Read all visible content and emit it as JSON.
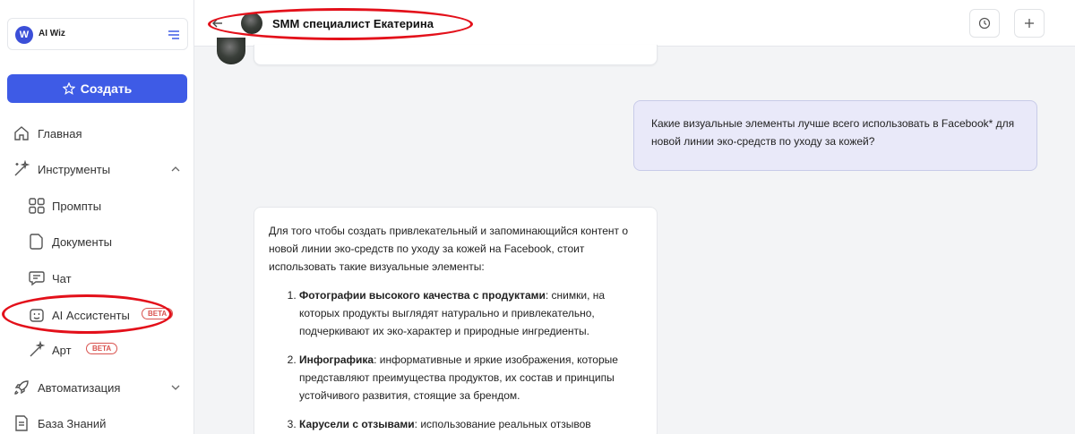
{
  "sidebar": {
    "brand_name": "AI Wiz",
    "create_label": "Создать",
    "items": {
      "home": "Главная",
      "tools": "Инструменты",
      "prompts": "Промпты",
      "documents": "Документы",
      "chat": "Чат",
      "assistants": "AI Ассистенты",
      "art": "Арт",
      "automation": "Автоматизация",
      "knowledge": "База Знаний"
    },
    "beta_label": "BETA"
  },
  "header": {
    "title": "SMM специалист Екатерина"
  },
  "chat": {
    "user_message": "Какие визуальные элементы лучше всего использовать в Facebook* для новой линии эко-средств по уходу за кожей?",
    "bot_intro": "Для того чтобы создать привлекательный и запоминающийся контент о новой линии эко-средств по уходу за кожей на Facebook, стоит использовать такие визуальные элементы:",
    "bot_items": [
      {
        "title": "Фотографии высокого качества с продуктами",
        "text": ": снимки, на которых продукты выглядят натурально и привлекательно, подчеркивают их эко-характер и природные ингредиенты."
      },
      {
        "title": "Инфографика",
        "text": ": информативные и яркие изображения, которые представляют преимущества продуктов, их состав и принципы устойчивого развития, стоящие за брендом."
      },
      {
        "title": "Карусели с отзывами",
        "text": ": использование реальных отзывов"
      }
    ]
  },
  "colors": {
    "accent": "#3e5be6",
    "highlight_ellipse": "#e3101a",
    "user_bubble": "#e9e9f9",
    "beta_badge": "#d9534f"
  }
}
